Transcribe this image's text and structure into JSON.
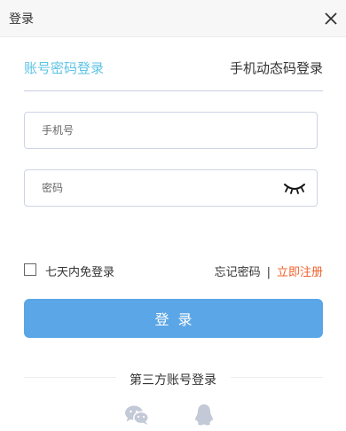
{
  "header": {
    "title": "登录"
  },
  "tabs": {
    "account": "账号密码登录",
    "phone": "手机动态码登录"
  },
  "form": {
    "phone_placeholder": "手机号",
    "password_placeholder": "密码",
    "remember_label": "七天内免登录",
    "forgot_label": "忘记密码",
    "separator": "|",
    "register_label": "立即注册",
    "login_label": "登录"
  },
  "third_party": {
    "title": "第三方账号登录",
    "icons": [
      "wechat-icon",
      "qq-icon"
    ]
  },
  "colors": {
    "accent": "#5bc3e4",
    "button": "#5ba6e6",
    "register": "#f0612b",
    "icon_gray": "#c3c9d6"
  }
}
